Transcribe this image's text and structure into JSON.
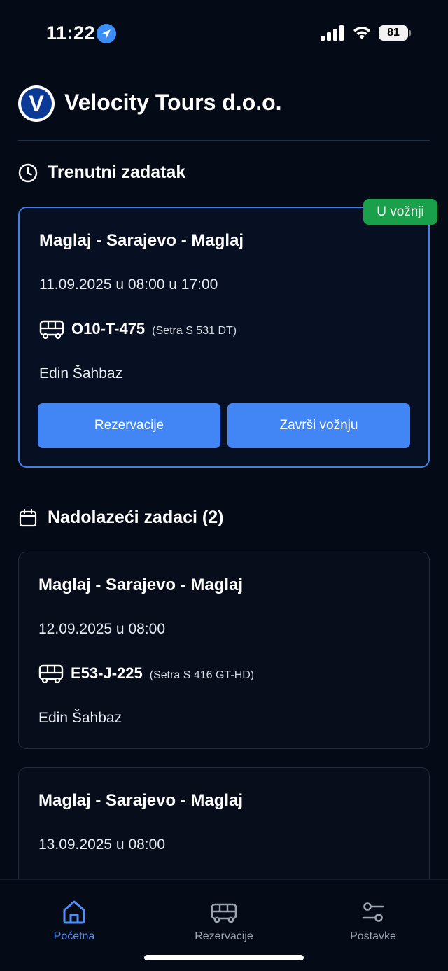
{
  "status_bar": {
    "time": "11:22",
    "battery": "81"
  },
  "header": {
    "company": "Velocity Tours d.o.o.",
    "logo_letter": "V"
  },
  "current_section": {
    "title": "Trenutni zadatak",
    "task": {
      "route": "Maglaj - Sarajevo - Maglaj",
      "datetime": "11.09.2025 u 08:00  u 17:00",
      "plate": "O10-T-475",
      "model": "(Setra S 531 DT)",
      "driver": "Edin Šahbaz",
      "status_badge": "U vožnji",
      "buttons": {
        "reservations": "Rezervacije",
        "finish": "Završi vožnju"
      }
    }
  },
  "upcoming_section": {
    "title": "Nadolazeći zadaci (2)",
    "tasks": [
      {
        "route": "Maglaj - Sarajevo - Maglaj",
        "datetime": "12.09.2025 u 08:00",
        "plate": "E53-J-225",
        "model": "(Setra S 416 GT-HD)",
        "driver": "Edin Šahbaz"
      },
      {
        "route": "Maglaj - Sarajevo - Maglaj",
        "datetime": "13.09.2025 u 08:00"
      }
    ]
  },
  "bottom_nav": {
    "items": [
      {
        "label": "Početna",
        "icon": "home-icon",
        "active": true
      },
      {
        "label": "Rezervacije",
        "icon": "bus-icon",
        "active": false
      },
      {
        "label": "Postavke",
        "icon": "sliders-icon",
        "active": false
      }
    ]
  },
  "colors": {
    "background": "#050b16",
    "accent": "#4285f4",
    "badge": "#1aa04b",
    "active_border": "#3f7fe8"
  }
}
